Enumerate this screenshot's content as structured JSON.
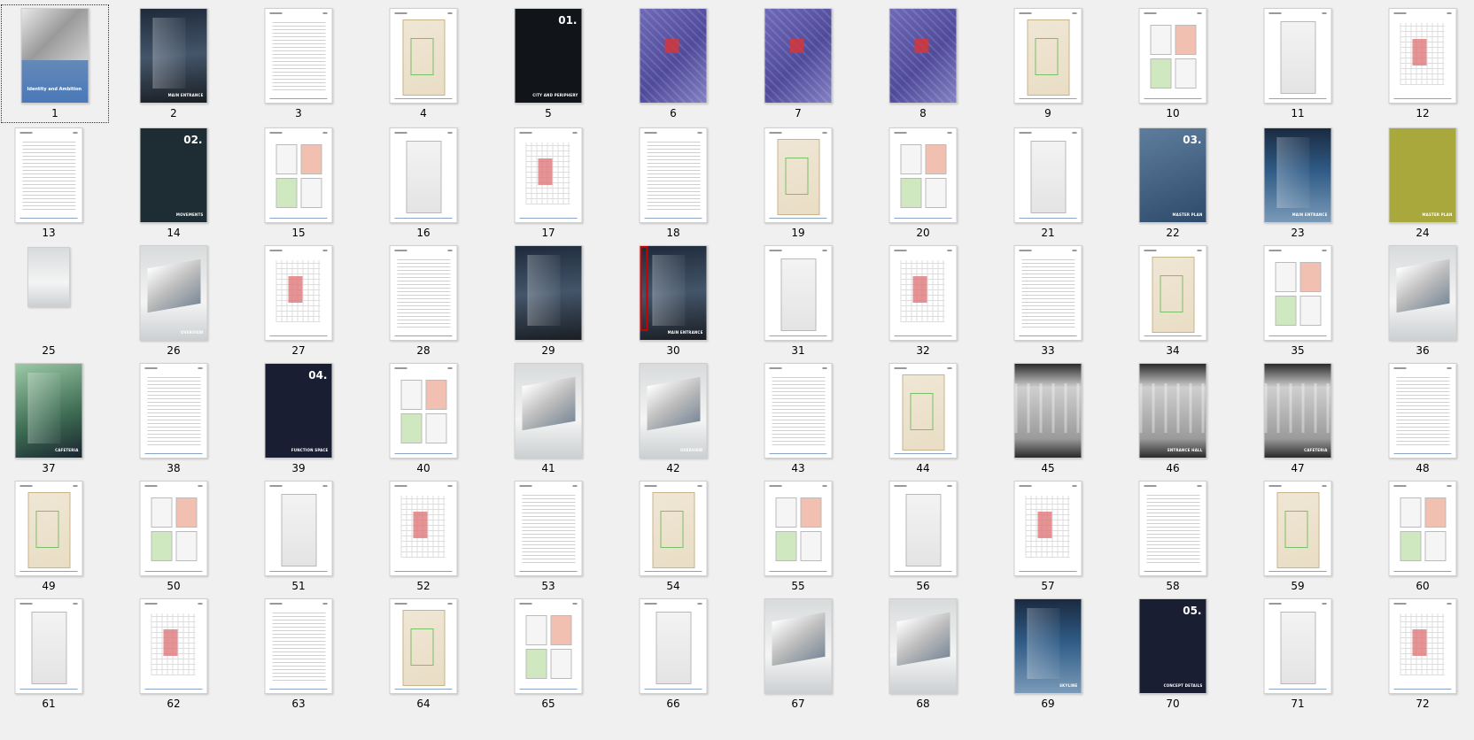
{
  "selected_page": "1",
  "pages": [
    {
      "num": "1",
      "style": "cover",
      "selected": true,
      "title_text": "Identity and Ambition"
    },
    {
      "num": "2",
      "style": "photo",
      "caption": "MAIN ENTRANCE"
    },
    {
      "num": "3",
      "style": "white"
    },
    {
      "num": "4",
      "style": "white"
    },
    {
      "num": "5",
      "style": "dark",
      "big": "01.",
      "caption": "CITY AND PERIPHERY"
    },
    {
      "num": "6",
      "style": "purple"
    },
    {
      "num": "7",
      "style": "purple"
    },
    {
      "num": "8",
      "style": "purple"
    },
    {
      "num": "9",
      "style": "white"
    },
    {
      "num": "10",
      "style": "white"
    },
    {
      "num": "11",
      "style": "white"
    },
    {
      "num": "12",
      "style": "white"
    },
    {
      "num": "13",
      "style": "white"
    },
    {
      "num": "14",
      "style": "teal",
      "big": "02.",
      "caption": "MOVEMENTS"
    },
    {
      "num": "15",
      "style": "white"
    },
    {
      "num": "16",
      "style": "white"
    },
    {
      "num": "17",
      "style": "white"
    },
    {
      "num": "18",
      "style": "white"
    },
    {
      "num": "19",
      "style": "white"
    },
    {
      "num": "20",
      "style": "white"
    },
    {
      "num": "21",
      "style": "white"
    },
    {
      "num": "22",
      "style": "bluegray",
      "big": "03.",
      "caption": "MASTER PLAN"
    },
    {
      "num": "23",
      "style": "skyline",
      "caption": "MAIN ENTRANCE"
    },
    {
      "num": "24",
      "style": "olive",
      "caption": "MASTER PLAN"
    },
    {
      "num": "25",
      "style": "small"
    },
    {
      "num": "26",
      "style": "photo-light",
      "caption": "OVERVIEW"
    },
    {
      "num": "27",
      "style": "white"
    },
    {
      "num": "28",
      "style": "white"
    },
    {
      "num": "29",
      "style": "photo"
    },
    {
      "num": "30",
      "style": "photo",
      "caption": "MAIN ENTRANCE"
    },
    {
      "num": "31",
      "style": "white"
    },
    {
      "num": "32",
      "style": "white"
    },
    {
      "num": "33",
      "style": "white"
    },
    {
      "num": "34",
      "style": "white"
    },
    {
      "num": "35",
      "style": "white"
    },
    {
      "num": "36",
      "style": "photo-light"
    },
    {
      "num": "37",
      "style": "green",
      "caption": "CAFETERIA"
    },
    {
      "num": "38",
      "style": "white"
    },
    {
      "num": "39",
      "style": "navy",
      "big": "04.",
      "caption": "FUNCTION SPACE"
    },
    {
      "num": "40",
      "style": "white"
    },
    {
      "num": "41",
      "style": "photo-light"
    },
    {
      "num": "42",
      "style": "photo-light",
      "caption": "OVERVIEW"
    },
    {
      "num": "43",
      "style": "white"
    },
    {
      "num": "44",
      "style": "white"
    },
    {
      "num": "45",
      "style": "interior"
    },
    {
      "num": "46",
      "style": "interior",
      "caption": "ENTRANCE HALL"
    },
    {
      "num": "47",
      "style": "interior",
      "caption": "CAFETERIA"
    },
    {
      "num": "48",
      "style": "white"
    },
    {
      "num": "49",
      "style": "white"
    },
    {
      "num": "50",
      "style": "white"
    },
    {
      "num": "51",
      "style": "white"
    },
    {
      "num": "52",
      "style": "white"
    },
    {
      "num": "53",
      "style": "white"
    },
    {
      "num": "54",
      "style": "white"
    },
    {
      "num": "55",
      "style": "white"
    },
    {
      "num": "56",
      "style": "white"
    },
    {
      "num": "57",
      "style": "white"
    },
    {
      "num": "58",
      "style": "white"
    },
    {
      "num": "59",
      "style": "white"
    },
    {
      "num": "60",
      "style": "white"
    },
    {
      "num": "61",
      "style": "white"
    },
    {
      "num": "62",
      "style": "white"
    },
    {
      "num": "63",
      "style": "white"
    },
    {
      "num": "64",
      "style": "white"
    },
    {
      "num": "65",
      "style": "white"
    },
    {
      "num": "66",
      "style": "white"
    },
    {
      "num": "67",
      "style": "photo-light"
    },
    {
      "num": "68",
      "style": "photo-light"
    },
    {
      "num": "69",
      "style": "skyline",
      "caption": "SKYLINE"
    },
    {
      "num": "70",
      "style": "navy",
      "big": "05.",
      "caption": "CONCEPT DETAILS"
    },
    {
      "num": "71",
      "style": "white"
    },
    {
      "num": "72",
      "style": "white"
    }
  ],
  "colors": {
    "background": "#f0f0f0",
    "selection_outline": "#333333",
    "thumb_border": "#cfcfcf",
    "page_30_marker": "#cc0000"
  }
}
